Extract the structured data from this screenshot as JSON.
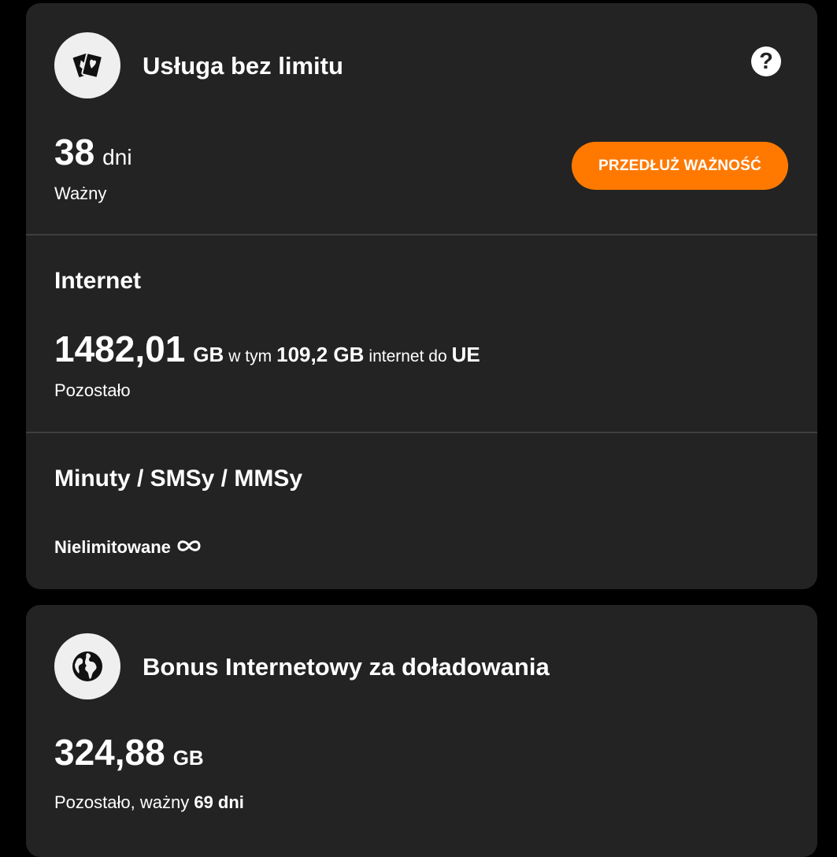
{
  "card_unlimited": {
    "title": "Usługa bez limitu",
    "help_label": "?",
    "validity": {
      "value": "38",
      "unit": "dni",
      "label": "Ważny"
    },
    "extend_button_label": "PRZEDŁUŻ WAŻNOŚĆ",
    "internet": {
      "title": "Internet",
      "value": "1482,01",
      "unit": "GB",
      "connector": "w tym",
      "eu_value": "109,2 GB",
      "eu_text": "internet do",
      "eu_region": "UE",
      "label": "Pozostało"
    },
    "calls": {
      "title": "Minuty / SMSy / MMSy",
      "value": "Nielimitowane"
    }
  },
  "card_bonus": {
    "title": "Bonus Internetowy za doładowania",
    "value": "324,88",
    "unit": "GB",
    "label_prefix": "Pozostało, ważny",
    "label_days": "69 dni"
  },
  "colors": {
    "background": "#000000",
    "card": "#232323",
    "accent": "#ff7900",
    "icon_circle": "#efefef",
    "divider": "#3e3e3e"
  },
  "icons": {
    "card_unlimited": "playing-cards-icon",
    "help": "question-mark-icon",
    "calls_unlimited": "infinity-icon",
    "card_bonus": "globe-icon"
  }
}
